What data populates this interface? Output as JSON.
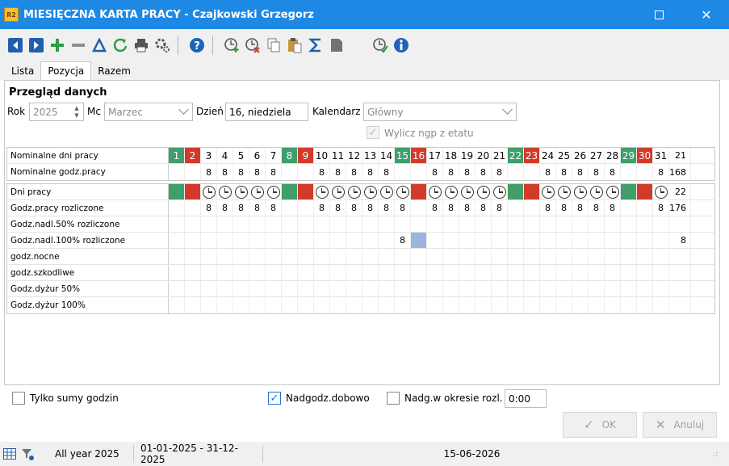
{
  "window": {
    "app_icon_text": "R2",
    "title": "MIESIĘCZNA KARTA PRACY - Czajkowski Grzegorz"
  },
  "toolbar": {
    "icons": [
      "prev-icon",
      "next-icon",
      "add-icon",
      "remove-icon",
      "delta-icon",
      "refresh-icon",
      "print-icon",
      "settings-icon",
      "help-icon",
      "add-time-icon",
      "remove-time-icon",
      "copy-icon",
      "paste-icon",
      "sum-icon",
      "file-icon",
      "time-check-icon",
      "info-icon"
    ],
    "colors": {
      "blue": "#1f5fae",
      "green": "#2e9d45",
      "gray": "#6f7378",
      "help": "#1e63b8"
    }
  },
  "tabs": [
    {
      "label": "Lista",
      "active": false
    },
    {
      "label": "Pozycja",
      "active": true
    },
    {
      "label": "Razem",
      "active": false
    }
  ],
  "form": {
    "section_title": "Przegląd danych",
    "rok_label": "Rok",
    "rok_value": "2025",
    "mc_label": "Mc",
    "mc_value": "Marzec",
    "dzien_label": "Dzień",
    "dzien_value": "16, niedziela",
    "kalendarz_label": "Kalendarz",
    "kalendarz_value": "Główny",
    "wylicz_label": "Wylicz ngp z etatu",
    "wylicz_checked": true
  },
  "grid": {
    "colors": {
      "green": "#3f9e6a",
      "red": "#d23a2b",
      "selected": "#9bb6dd"
    },
    "days": [
      "1",
      "2",
      "3",
      "4",
      "5",
      "6",
      "7",
      "8",
      "9",
      "10",
      "11",
      "12",
      "13",
      "14",
      "15",
      "16",
      "17",
      "18",
      "19",
      "20",
      "21",
      "22",
      "23",
      "24",
      "25",
      "26",
      "27",
      "28",
      "29",
      "30",
      "31"
    ],
    "day_types": [
      "g",
      "r",
      "",
      "",
      "",
      "",
      "",
      "g",
      "r",
      "",
      "",
      "",
      "",
      "",
      "g",
      "r",
      "",
      "",
      "",
      "",
      "",
      "g",
      "r",
      "",
      "",
      "",
      "",
      "",
      "g",
      "r",
      ""
    ],
    "nominal_days_total": "21",
    "nominal_hours_total": "168",
    "rows_top": [
      {
        "label": "Nominalne dni pracy"
      },
      {
        "label": "Nominalne godz.pracy",
        "values": [
          "",
          "",
          "8",
          "8",
          "8",
          "8",
          "8",
          "",
          "",
          "8",
          "8",
          "8",
          "8",
          "8",
          "",
          "",
          "8",
          "8",
          "8",
          "8",
          "8",
          "",
          "",
          "8",
          "8",
          "8",
          "8",
          "8",
          "",
          "",
          "8"
        ]
      }
    ],
    "work_days": [
      "g",
      "r",
      "c",
      "c",
      "c",
      "c",
      "c",
      "g",
      "r",
      "c",
      "c",
      "c",
      "c",
      "c",
      "c",
      "r",
      "c",
      "c",
      "c",
      "c",
      "c",
      "g",
      "r",
      "c",
      "c",
      "c",
      "c",
      "c",
      "g",
      "r",
      "c"
    ],
    "rows_bottom": [
      {
        "label": "Dni pracy",
        "total": "22"
      },
      {
        "label": "Godz.pracy rozliczone",
        "total": "176",
        "values": [
          "",
          "",
          "8",
          "8",
          "8",
          "8",
          "8",
          "",
          "",
          "8",
          "8",
          "8",
          "8",
          "8",
          "8",
          "",
          "8",
          "8",
          "8",
          "8",
          "8",
          "",
          "",
          "8",
          "8",
          "8",
          "8",
          "8",
          "",
          "",
          "8"
        ]
      },
      {
        "label": "Godz.nadl.50% rozliczone",
        "total": ""
      },
      {
        "label": "Godz.nadl.100% rozliczone",
        "total": "8",
        "values": [
          "",
          "",
          "",
          "",
          "",
          "",
          "",
          "",
          "",
          "",
          "",
          "",
          "",
          "",
          "8",
          "",
          "",
          "",
          "",
          "",
          "",
          "",
          "",
          "",
          "",
          "",
          "",
          "",
          "",
          "",
          ""
        ]
      },
      {
        "label": "godz.nocne",
        "total": ""
      },
      {
        "label": "godz.szkodliwe",
        "total": ""
      },
      {
        "label": "Godz.dyżur 50%",
        "total": ""
      },
      {
        "label": "Godz.dyżur 100%",
        "total": ""
      }
    ],
    "selected_day_index": 15
  },
  "options": {
    "tylko_sumy_label": "Tylko sumy godzin",
    "tylko_sumy_checked": false,
    "nadgodz_dobowo_label": "Nadgodz.dobowo",
    "nadgodz_dobowo_checked": true,
    "nadg_okres_label": "Nadg.w okresie rozl.",
    "nadg_okres_checked": false,
    "nadg_okres_value": "0:00"
  },
  "buttons": {
    "ok_label": "OK",
    "anuluj_label": "Anuluj"
  },
  "statusbar": {
    "period_label": "All year 2025",
    "date_range": "01-01-2025 - 31-12-2025",
    "date": "15-06-2026"
  }
}
